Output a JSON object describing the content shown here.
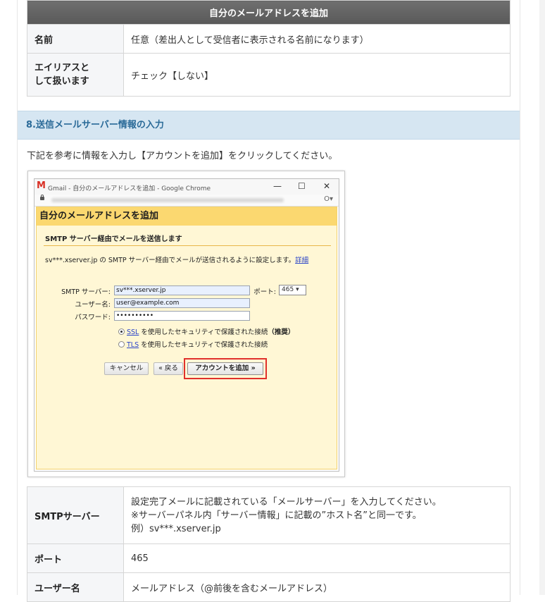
{
  "alias_table": {
    "header": "自分のメールアドレスを追加",
    "rows": [
      {
        "key": "名前",
        "value": "任意（差出人として受信者に表示される名前になります）"
      },
      {
        "key": "エイリアスとして扱います",
        "value": "チェック【しない】"
      }
    ]
  },
  "section": {
    "heading": "8.送信メールサーバー情報の入力",
    "instruction": "下記を参考に情報を入力し【アカウントを追加】をクリックしてください。"
  },
  "screenshot": {
    "window_title": "Gmail - 自分のメールアドレスを追加 - Google Chrome",
    "controls": {
      "minimize": "—",
      "maximize": "☐",
      "close": "✕"
    },
    "key_icon": "O▾",
    "panel_title": "自分のメールアドレスを追加",
    "subheading": "SMTP サーバー経由でメールを送信します",
    "description": "sv***.xserver.jp の SMTP サーバー経由でメールが送信されるように設定します。",
    "details_link": "詳細",
    "smtp_label": "SMTP サーバー:",
    "smtp_value": "sv***.xserver.jp",
    "port_label": "ポート:",
    "port_value": "465",
    "port_arrow": "▾",
    "username_label": "ユーザー名:",
    "username_value": "user@example.com",
    "password_label": "パスワード:",
    "password_value": "••••••••••",
    "ssl_link": "SSL",
    "ssl_text": "を使用したセキュリティで保護された接続",
    "ssl_recommended": "（推奨）",
    "tls_link": "TLS",
    "tls_text": "を使用したセキュリティで保護された接続",
    "cancel_button": "キャンセル",
    "back_button": "« 戻る",
    "add_account_button": "アカウントを追加 »"
  },
  "smtp_table": {
    "rows": [
      {
        "key": "SMTPサーバー",
        "lines": [
          "設定完了メールに記載されている「メールサーバー」を入力してください。",
          "※サーバーパネル内「サーバー情報」に記載の”ホスト名”と同一です。",
          "例）sv***.xserver.jp"
        ]
      },
      {
        "key": "ポート",
        "value": "465"
      },
      {
        "key": "ユーザー名",
        "value": "メールアドレス（@前後を含むメールアドレス）"
      }
    ]
  }
}
